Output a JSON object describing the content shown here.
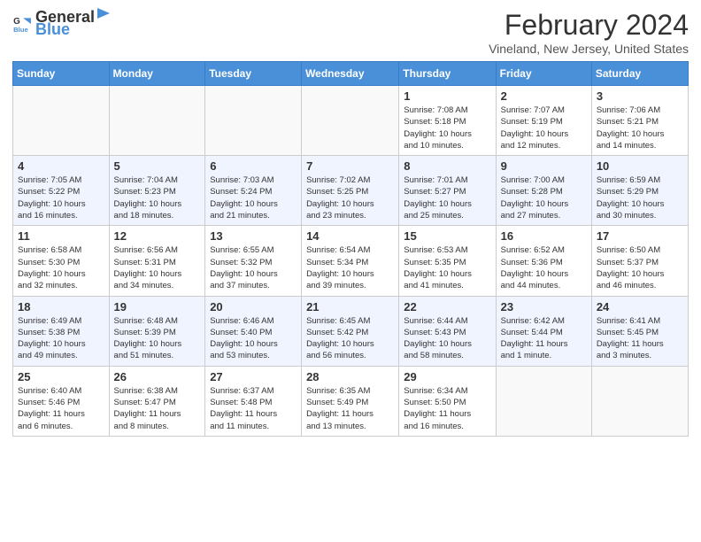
{
  "header": {
    "logo_general": "General",
    "logo_blue": "Blue",
    "month_title": "February 2024",
    "location": "Vineland, New Jersey, United States"
  },
  "weekdays": [
    "Sunday",
    "Monday",
    "Tuesday",
    "Wednesday",
    "Thursday",
    "Friday",
    "Saturday"
  ],
  "weeks": [
    [
      {
        "day": "",
        "info": ""
      },
      {
        "day": "",
        "info": ""
      },
      {
        "day": "",
        "info": ""
      },
      {
        "day": "",
        "info": ""
      },
      {
        "day": "1",
        "info": "Sunrise: 7:08 AM\nSunset: 5:18 PM\nDaylight: 10 hours\nand 10 minutes."
      },
      {
        "day": "2",
        "info": "Sunrise: 7:07 AM\nSunset: 5:19 PM\nDaylight: 10 hours\nand 12 minutes."
      },
      {
        "day": "3",
        "info": "Sunrise: 7:06 AM\nSunset: 5:21 PM\nDaylight: 10 hours\nand 14 minutes."
      }
    ],
    [
      {
        "day": "4",
        "info": "Sunrise: 7:05 AM\nSunset: 5:22 PM\nDaylight: 10 hours\nand 16 minutes."
      },
      {
        "day": "5",
        "info": "Sunrise: 7:04 AM\nSunset: 5:23 PM\nDaylight: 10 hours\nand 18 minutes."
      },
      {
        "day": "6",
        "info": "Sunrise: 7:03 AM\nSunset: 5:24 PM\nDaylight: 10 hours\nand 21 minutes."
      },
      {
        "day": "7",
        "info": "Sunrise: 7:02 AM\nSunset: 5:25 PM\nDaylight: 10 hours\nand 23 minutes."
      },
      {
        "day": "8",
        "info": "Sunrise: 7:01 AM\nSunset: 5:27 PM\nDaylight: 10 hours\nand 25 minutes."
      },
      {
        "day": "9",
        "info": "Sunrise: 7:00 AM\nSunset: 5:28 PM\nDaylight: 10 hours\nand 27 minutes."
      },
      {
        "day": "10",
        "info": "Sunrise: 6:59 AM\nSunset: 5:29 PM\nDaylight: 10 hours\nand 30 minutes."
      }
    ],
    [
      {
        "day": "11",
        "info": "Sunrise: 6:58 AM\nSunset: 5:30 PM\nDaylight: 10 hours\nand 32 minutes."
      },
      {
        "day": "12",
        "info": "Sunrise: 6:56 AM\nSunset: 5:31 PM\nDaylight: 10 hours\nand 34 minutes."
      },
      {
        "day": "13",
        "info": "Sunrise: 6:55 AM\nSunset: 5:32 PM\nDaylight: 10 hours\nand 37 minutes."
      },
      {
        "day": "14",
        "info": "Sunrise: 6:54 AM\nSunset: 5:34 PM\nDaylight: 10 hours\nand 39 minutes."
      },
      {
        "day": "15",
        "info": "Sunrise: 6:53 AM\nSunset: 5:35 PM\nDaylight: 10 hours\nand 41 minutes."
      },
      {
        "day": "16",
        "info": "Sunrise: 6:52 AM\nSunset: 5:36 PM\nDaylight: 10 hours\nand 44 minutes."
      },
      {
        "day": "17",
        "info": "Sunrise: 6:50 AM\nSunset: 5:37 PM\nDaylight: 10 hours\nand 46 minutes."
      }
    ],
    [
      {
        "day": "18",
        "info": "Sunrise: 6:49 AM\nSunset: 5:38 PM\nDaylight: 10 hours\nand 49 minutes."
      },
      {
        "day": "19",
        "info": "Sunrise: 6:48 AM\nSunset: 5:39 PM\nDaylight: 10 hours\nand 51 minutes."
      },
      {
        "day": "20",
        "info": "Sunrise: 6:46 AM\nSunset: 5:40 PM\nDaylight: 10 hours\nand 53 minutes."
      },
      {
        "day": "21",
        "info": "Sunrise: 6:45 AM\nSunset: 5:42 PM\nDaylight: 10 hours\nand 56 minutes."
      },
      {
        "day": "22",
        "info": "Sunrise: 6:44 AM\nSunset: 5:43 PM\nDaylight: 10 hours\nand 58 minutes."
      },
      {
        "day": "23",
        "info": "Sunrise: 6:42 AM\nSunset: 5:44 PM\nDaylight: 11 hours\nand 1 minute."
      },
      {
        "day": "24",
        "info": "Sunrise: 6:41 AM\nSunset: 5:45 PM\nDaylight: 11 hours\nand 3 minutes."
      }
    ],
    [
      {
        "day": "25",
        "info": "Sunrise: 6:40 AM\nSunset: 5:46 PM\nDaylight: 11 hours\nand 6 minutes."
      },
      {
        "day": "26",
        "info": "Sunrise: 6:38 AM\nSunset: 5:47 PM\nDaylight: 11 hours\nand 8 minutes."
      },
      {
        "day": "27",
        "info": "Sunrise: 6:37 AM\nSunset: 5:48 PM\nDaylight: 11 hours\nand 11 minutes."
      },
      {
        "day": "28",
        "info": "Sunrise: 6:35 AM\nSunset: 5:49 PM\nDaylight: 11 hours\nand 13 minutes."
      },
      {
        "day": "29",
        "info": "Sunrise: 6:34 AM\nSunset: 5:50 PM\nDaylight: 11 hours\nand 16 minutes."
      },
      {
        "day": "",
        "info": ""
      },
      {
        "day": "",
        "info": ""
      }
    ]
  ]
}
